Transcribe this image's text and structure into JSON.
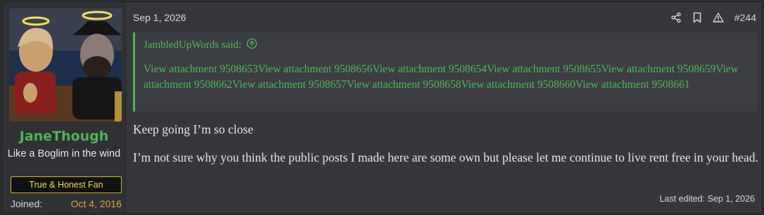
{
  "user": {
    "username": "JaneThough",
    "title": "Like a Boglim in the wind",
    "banner": "True & Honest Fan",
    "joined_label": "Joined:",
    "joined_value": "Oct 4, 2016"
  },
  "post": {
    "date": "Sep 1, 2026",
    "number": "#244",
    "quote": {
      "author": "JambledUpWords said:",
      "attachments": [
        "View attachment 9508653",
        "View attachment 9508656",
        "View attachment 9508654",
        "View attachment 9508655",
        "View attachment 9508659",
        "View attachment 9508662",
        "View attachment 9508657",
        "View attachment 9508658",
        "View attachment 9508660",
        "View attachment 9508661"
      ]
    },
    "message": [
      "Keep going I’m so close",
      "I’m not sure why you think the public posts I made here are some own but please let me continue to live rent free in your head."
    ],
    "last_edited": "Last edited: Sep 1, 2026"
  },
  "colors": {
    "accent_green": "#4eb556",
    "banner_gold": "#d8b70f",
    "joined_orange": "#d9a53c"
  },
  "icons": [
    "share-icon",
    "bookmark-icon",
    "report-icon",
    "quote-arrow-up-icon"
  ]
}
